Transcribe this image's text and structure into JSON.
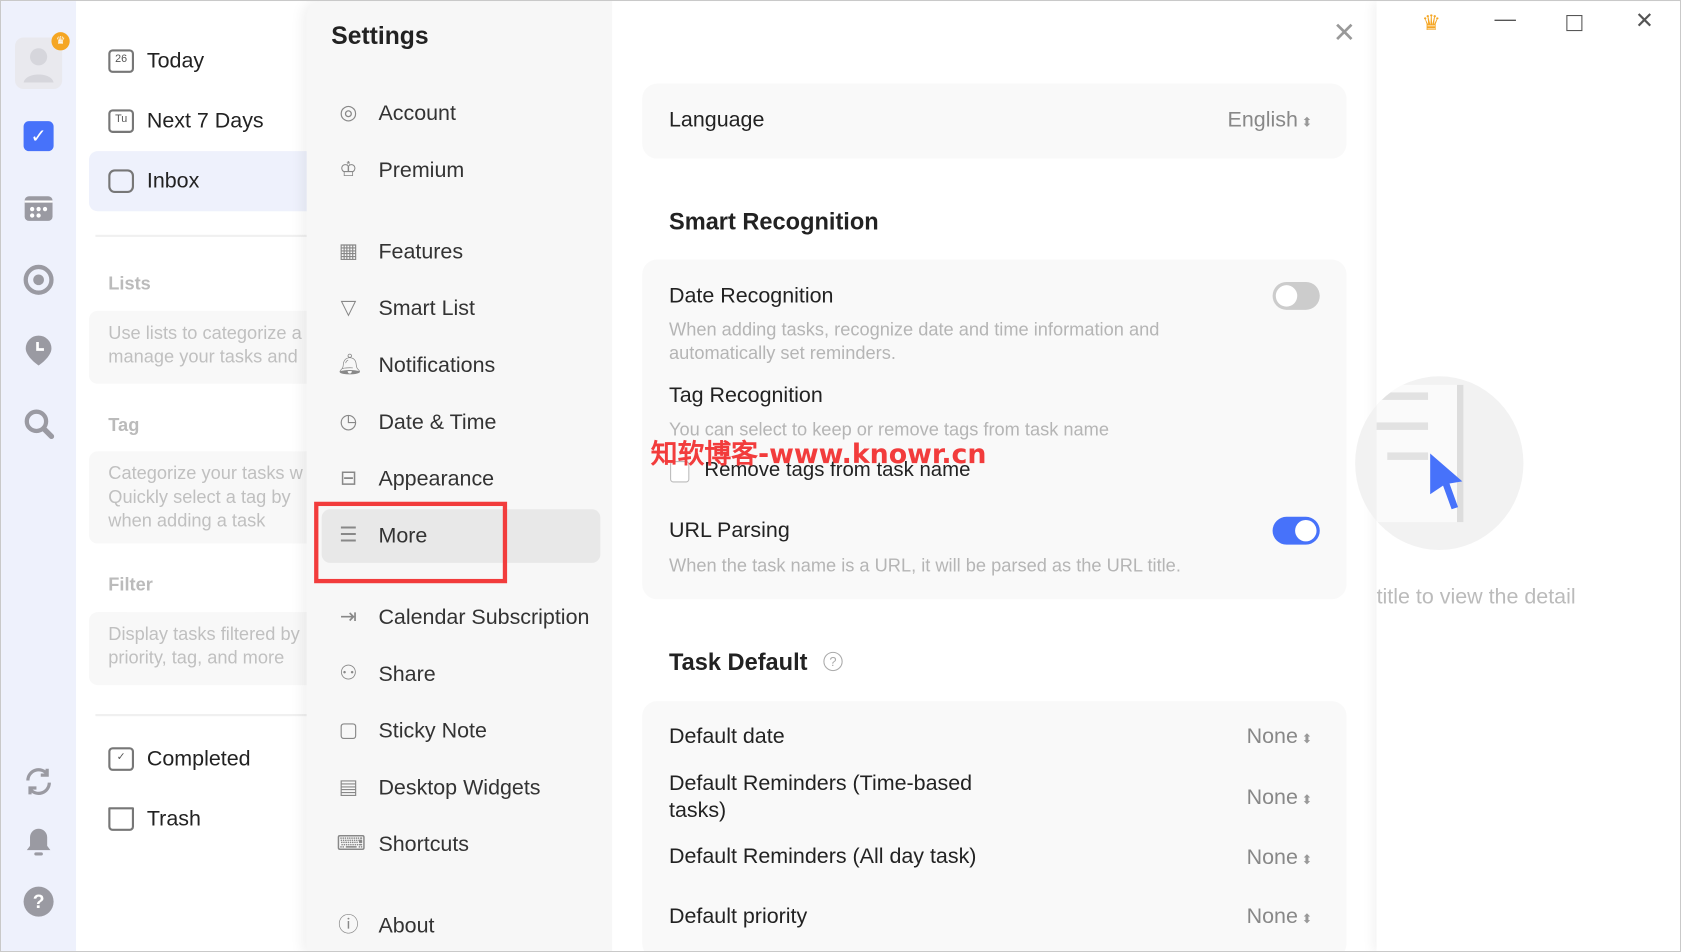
{
  "sidebar": {
    "items": [
      {
        "label": "Today",
        "icon_text": "26"
      },
      {
        "label": "Next 7 Days",
        "icon_text": "Tu"
      },
      {
        "label": "Inbox"
      }
    ],
    "lists_title": "Lists",
    "lists_hint": [
      "Use lists to categorize a",
      "manage your tasks and"
    ],
    "tag_title": "Tag",
    "tag_hint": [
      "Categorize your tasks w",
      "Quickly select a tag by",
      "when adding a task"
    ],
    "filter_title": "Filter",
    "filter_hint": [
      "Display tasks filtered by",
      "priority, tag, and more"
    ],
    "completed": "Completed",
    "trash": "Trash"
  },
  "settings": {
    "title": "Settings",
    "nav": [
      "Account",
      "Premium",
      "Features",
      "Smart List",
      "Notifications",
      "Date & Time",
      "Appearance",
      "More",
      "Calendar Subscription",
      "Share",
      "Sticky Note",
      "Desktop Widgets",
      "Shortcuts",
      "About"
    ],
    "active": "More"
  },
  "content": {
    "language_label": "Language",
    "language_value": "English",
    "smart_title": "Smart Recognition",
    "date_rec": "Date Recognition",
    "date_rec_desc": [
      "When adding tasks, recognize date and time information and",
      "automatically set reminders."
    ],
    "date_rec_on": false,
    "tag_rec": "Tag Recognition",
    "tag_rec_desc": "You can select to keep or remove tags from task name",
    "remove_tags": "Remove tags from task name",
    "remove_tags_checked": false,
    "url_parsing": "URL Parsing",
    "url_desc": "When the task name is a URL, it will be parsed as the URL title.",
    "url_on": true,
    "task_default_title": "Task Default",
    "defaults": [
      {
        "label": "Default date",
        "value": "None"
      },
      {
        "label": "Default Reminders (Time-based tasks)",
        "value": "None"
      },
      {
        "label": "Default Reminders (All day task)",
        "value": "None"
      },
      {
        "label": "Default priority",
        "value": "None"
      }
    ]
  },
  "right": {
    "empty_text": "title to view the detail"
  },
  "watermark": "知软博客-www.knowr.cn",
  "colors": {
    "accent": "#4772fa",
    "premium": "#f5a623",
    "highlight_box": "#f23c3c"
  }
}
